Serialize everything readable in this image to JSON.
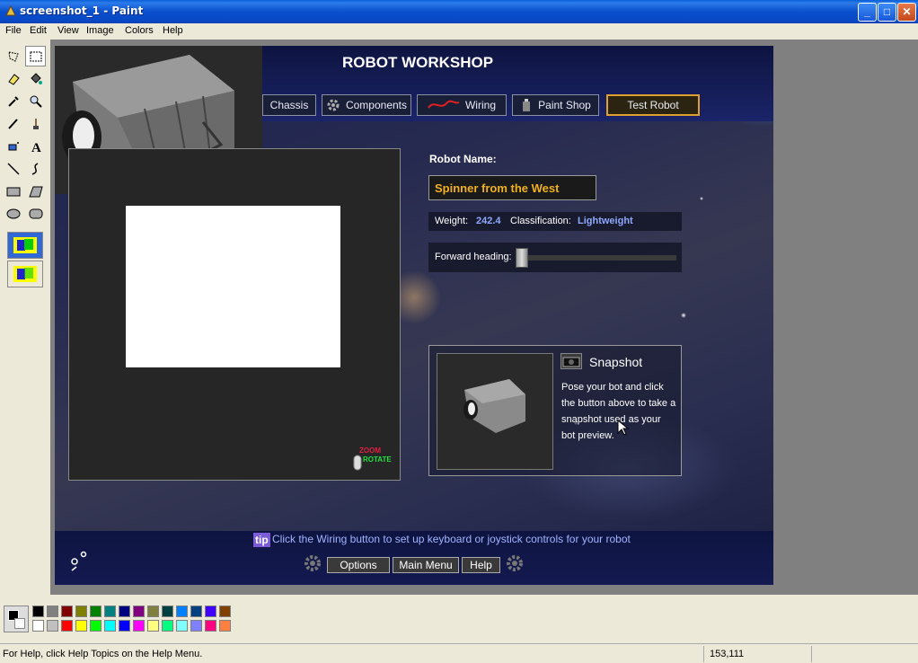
{
  "window": {
    "title": "screenshot_1 - Paint",
    "minimize": "_",
    "maximize": "□",
    "close": "✕"
  },
  "menu": [
    "File",
    "Edit",
    "View",
    "Image",
    "Colors",
    "Help"
  ],
  "game": {
    "title": "ROBOT WORKSHOP",
    "nav": [
      "Chassis",
      "Components",
      "Wiring",
      "Paint Shop",
      "Test Robot"
    ],
    "robot_name_label": "Robot Name:",
    "robot_name_value": "Spinner from the West",
    "weight_label": "Weight:",
    "weight_value": "242.4",
    "classification_label": "Classification:",
    "classification_value": "Lightweight",
    "heading_label": "Forward heading:",
    "zoom_label": "ZOOM",
    "rotate_label": "ROTATE",
    "snapshot_title": "Snapshot",
    "snapshot_desc": "Pose your bot and click the button above to take a snapshot used as your bot preview.",
    "tip_badge": "tip",
    "tip_text": "Click the Wiring button to set up keyboard or joystick controls for your robot",
    "footer_buttons": [
      "Options",
      "Main Menu",
      "Help"
    ]
  },
  "palette": {
    "top": [
      "#000000",
      "#808080",
      "#800000",
      "#808000",
      "#008000",
      "#008080",
      "#000080",
      "#800080",
      "#808040",
      "#004040",
      "#0080ff",
      "#004080",
      "#4000ff",
      "#804000"
    ],
    "bottom": [
      "#ffffff",
      "#c0c0c0",
      "#ff0000",
      "#ffff00",
      "#00ff00",
      "#00ffff",
      "#0000ff",
      "#ff00ff",
      "#ffff80",
      "#00ff80",
      "#80ffff",
      "#8080ff",
      "#ff0080",
      "#ff8040"
    ]
  },
  "status": {
    "help_text": "For Help, click Help Topics on the Help Menu.",
    "coords": "153,111"
  }
}
